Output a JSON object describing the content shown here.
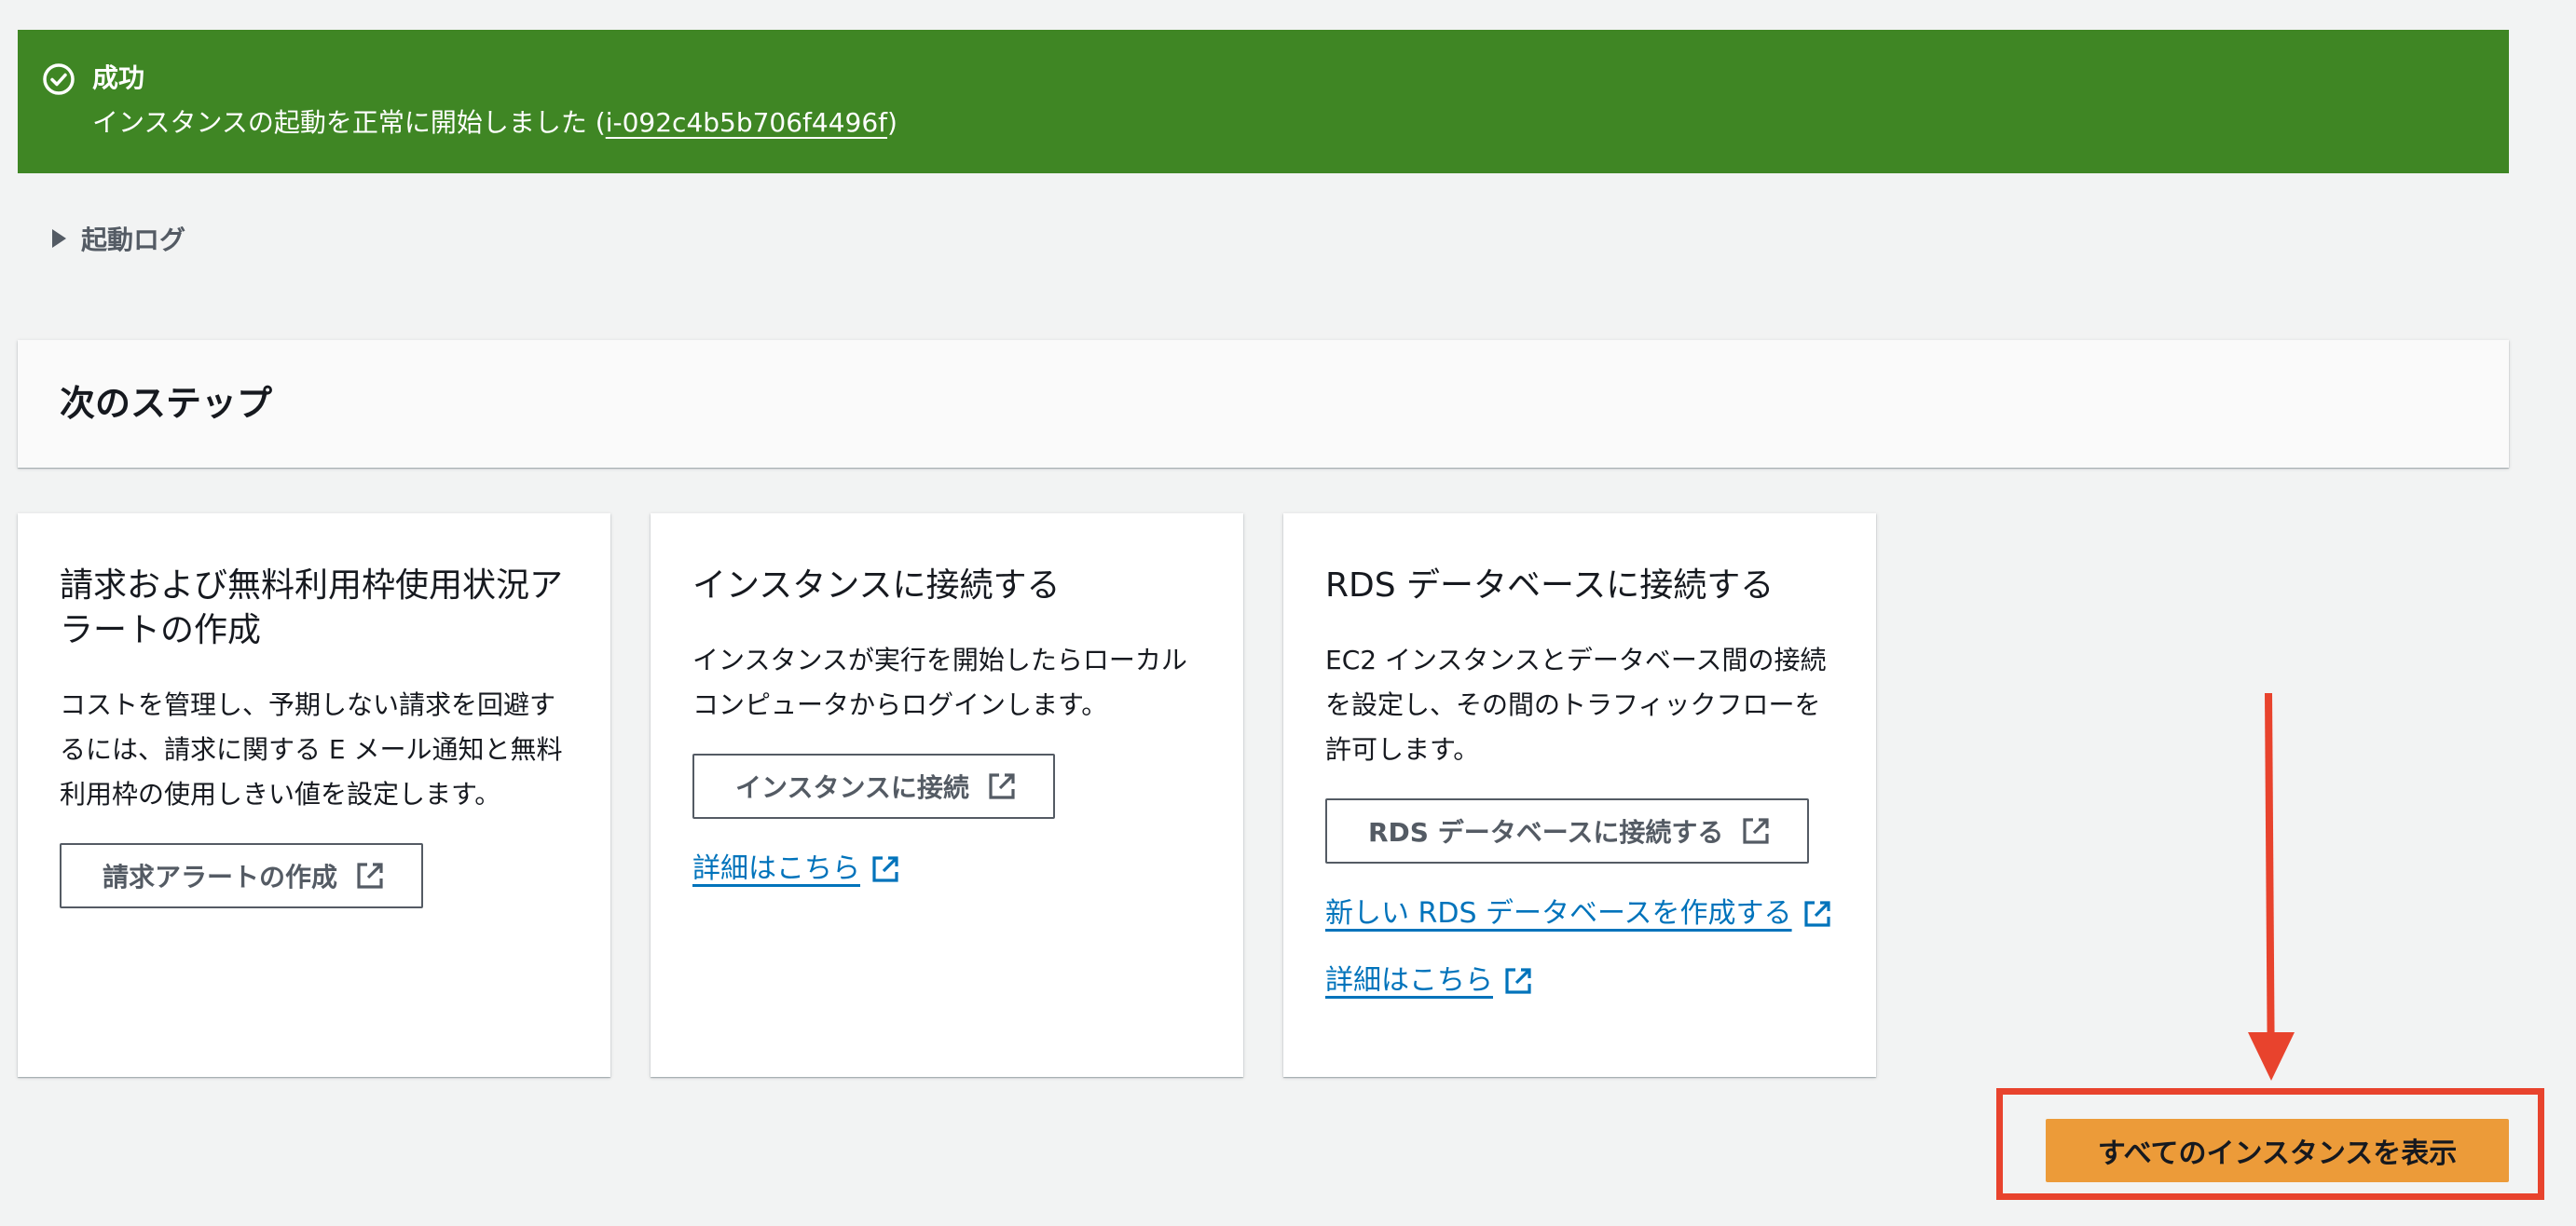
{
  "banner": {
    "title": "成功",
    "message_prefix": "インスタンスの起動を正常に開始しました (",
    "instance_id": "i-092c4b5b706f4496f",
    "message_suffix": ")",
    "color": "#3f8624"
  },
  "launch_log": {
    "label": "起動ログ"
  },
  "next_steps": {
    "title": "次のステップ"
  },
  "cards": [
    {
      "title": "請求および無料利用枠使用状況アラートの作成",
      "body": "コストを管理し、予期しない請求を回避するには、請求に関する E メール通知と無料利用枠の使用しきい値を設定します。",
      "button_label": "請求アラートの作成"
    },
    {
      "title": "インスタンスに接続する",
      "body": "インスタンスが実行を開始したらローカルコンピュータからログインします。",
      "button_label": "インスタンスに接続",
      "link_label": "詳細はこちら"
    },
    {
      "title": "RDS データベースに接続する",
      "body": "EC2 インスタンスとデータベース間の接続を設定し、その間のトラフィックフローを許可します。",
      "button_label": "RDS データベースに接続する",
      "link1_label": "新しい RDS データベースを作成する",
      "link2_label": "詳細はこちら"
    }
  ],
  "primary_action": {
    "label": "すべてのインスタンスを表示",
    "color": "#ec9b39"
  },
  "annotation": {
    "color": "#e8432d"
  },
  "icons": {
    "success": "check-circle-icon",
    "expand": "caret-right-icon",
    "external": "external-link-icon"
  }
}
